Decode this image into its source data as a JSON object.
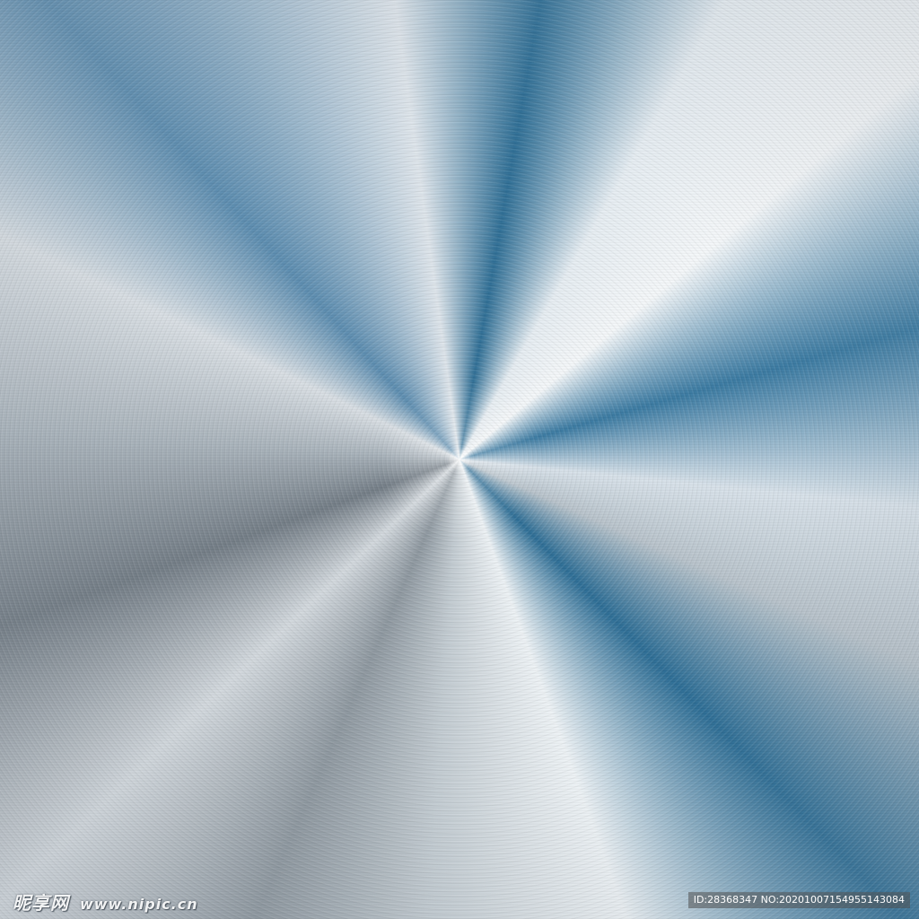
{
  "image": {
    "subject": "brushed metal radial burst",
    "colors": {
      "steel_blue": "#2f6f96",
      "silver": "#dfe6ec",
      "dark_gray": "#737d86"
    }
  },
  "watermark": {
    "logo_text": "昵享网",
    "url_text": "www.nipic.cn"
  },
  "id_bar": {
    "text": "ID:28368347 NO:20201007154955143084"
  }
}
